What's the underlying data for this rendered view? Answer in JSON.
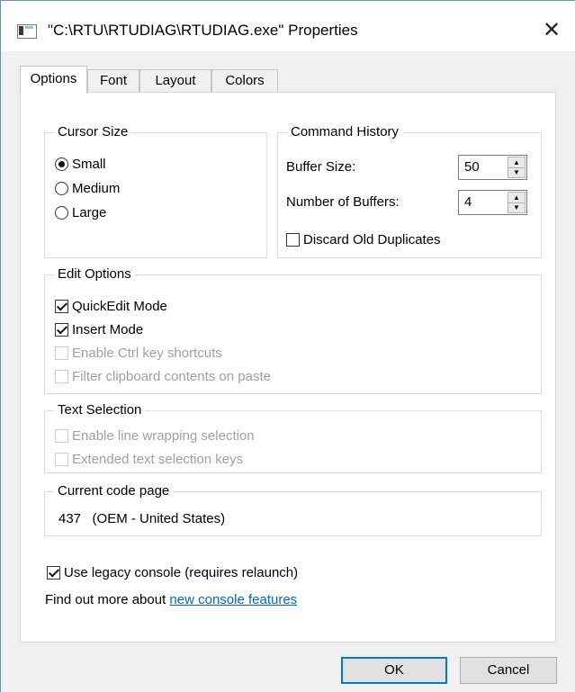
{
  "window": {
    "title": "\"C:\\RTU\\RTUDIAG\\RTUDIAG.exe\" Properties",
    "close_glyph": "✕",
    "icon": "console-window-icon"
  },
  "tabs": [
    {
      "label": "Options",
      "active": true
    },
    {
      "label": "Font",
      "active": false
    },
    {
      "label": "Layout",
      "active": false
    },
    {
      "label": "Colors",
      "active": false
    }
  ],
  "cursor_size": {
    "legend": "Cursor Size",
    "options": [
      {
        "label": "Small",
        "checked": true
      },
      {
        "label": "Medium",
        "checked": false
      },
      {
        "label": "Large",
        "checked": false
      }
    ]
  },
  "command_history": {
    "legend": "Command History",
    "buffer_size_label": "Buffer Size:",
    "buffer_size_value": "50",
    "num_buffers_label": "Number of Buffers:",
    "num_buffers_value": "4",
    "discard_label": "Discard Old Duplicates",
    "discard_checked": false
  },
  "edit_options": {
    "legend": "Edit Options",
    "items": [
      {
        "label": "QuickEdit Mode",
        "checked": true,
        "enabled": true
      },
      {
        "label": "Insert Mode",
        "checked": true,
        "enabled": true
      },
      {
        "label": "Enable Ctrl key shortcuts",
        "checked": false,
        "enabled": false
      },
      {
        "label": "Filter clipboard contents on paste",
        "checked": false,
        "enabled": false
      }
    ]
  },
  "text_selection": {
    "legend": "Text Selection",
    "items": [
      {
        "label": "Enable line wrapping selection",
        "checked": false,
        "enabled": false
      },
      {
        "label": "Extended text selection keys",
        "checked": false,
        "enabled": false
      }
    ]
  },
  "code_page": {
    "legend": "Current code page",
    "value": "437   (OEM - United States)"
  },
  "legacy": {
    "label": "Use legacy console (requires relaunch)",
    "checked": true
  },
  "find_out": {
    "prefix": "Find out more about ",
    "link": "new console features"
  },
  "buttons": {
    "ok": "OK",
    "cancel": "Cancel"
  },
  "colors": {
    "accent": "#0078d7",
    "link": "#0066cc",
    "disabled_text": "#a0a0a0"
  }
}
